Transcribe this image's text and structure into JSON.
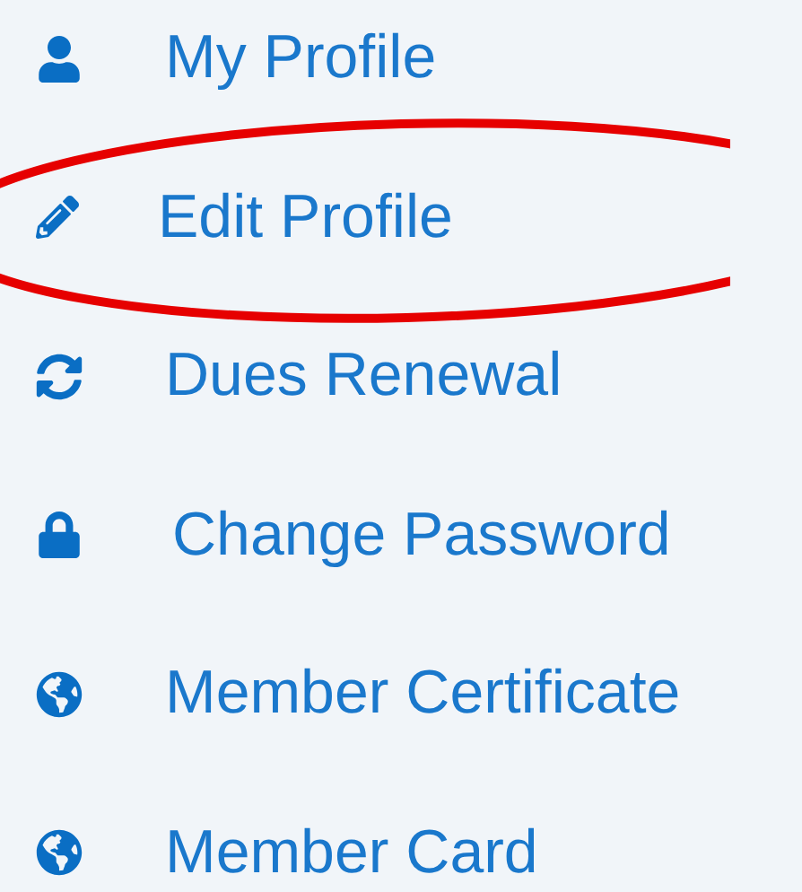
{
  "menu": {
    "items": [
      {
        "label": "My Profile",
        "circled": false
      },
      {
        "label": "Edit Profile",
        "circled": true
      },
      {
        "label": "Dues Renewal",
        "circled": false
      },
      {
        "label": "Change Password",
        "circled": false
      },
      {
        "label": "Member Certificate",
        "circled": false
      },
      {
        "label": "Member Card",
        "circled": false
      }
    ]
  }
}
